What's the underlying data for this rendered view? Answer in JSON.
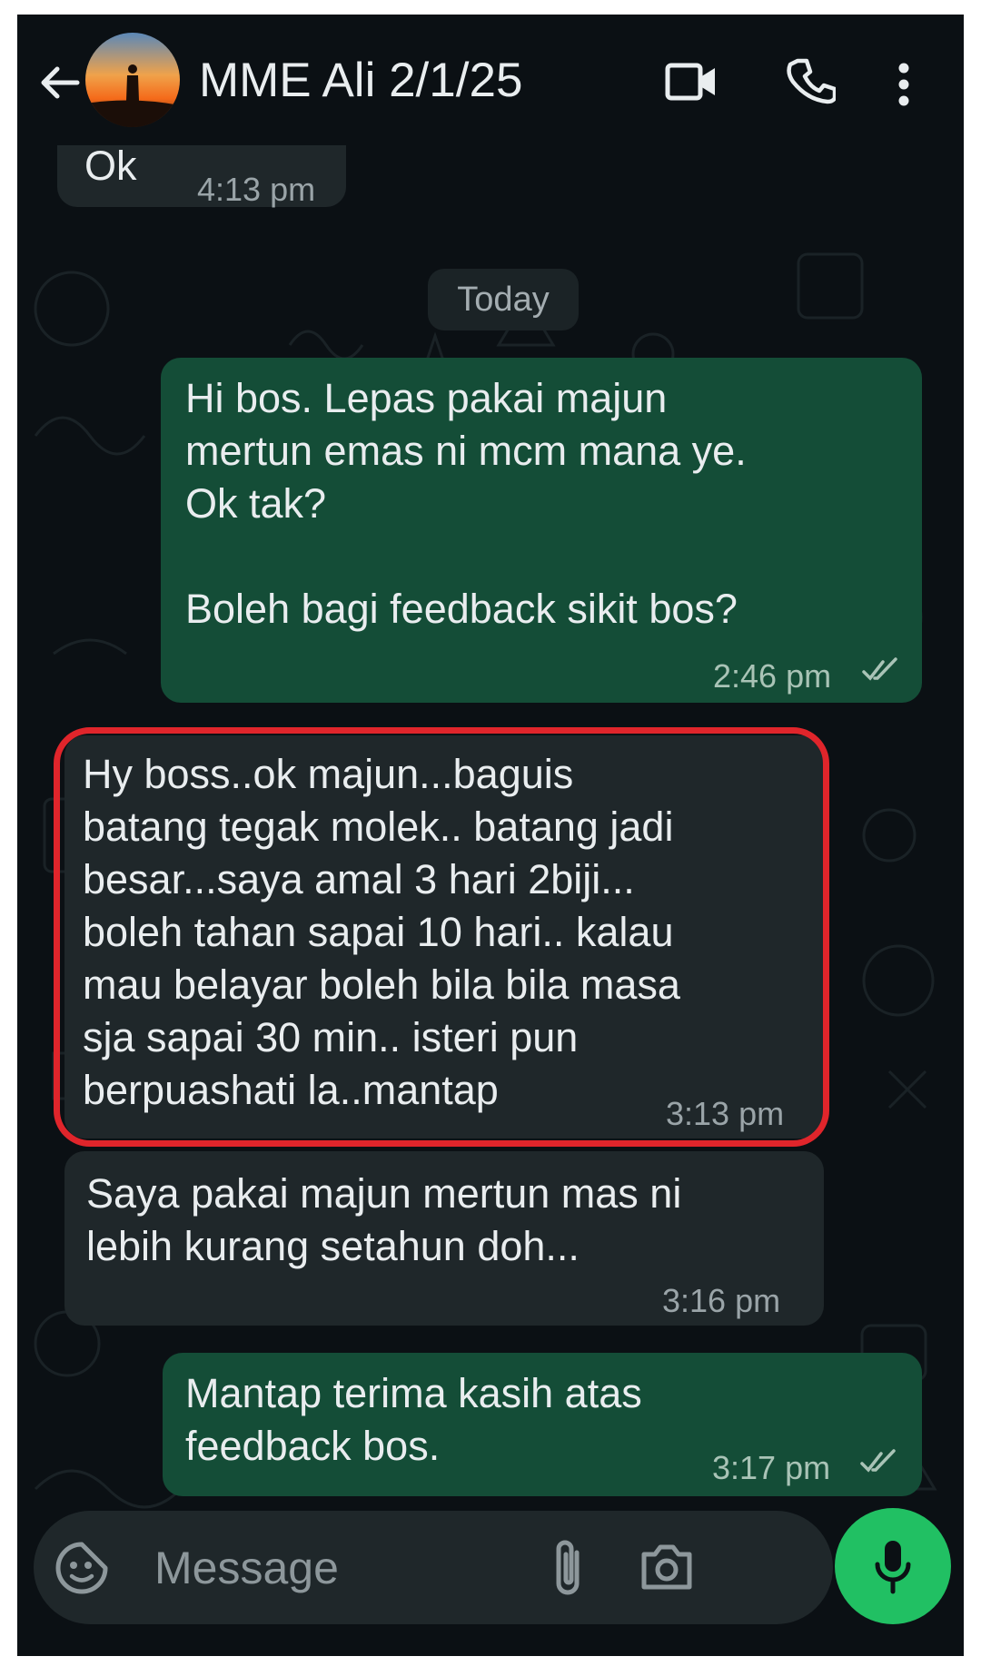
{
  "header": {
    "contact_name": "MME Ali 2/1/25"
  },
  "messages": [
    {
      "direction": "incoming",
      "text": "Ok",
      "time": "4:13 pm"
    },
    {
      "direction": "outgoing",
      "text": "Hi bos. Lepas pakai majun\nmertun emas ni mcm mana ye.\nOk tak?\n\nBoleh bagi feedback sikit bos?",
      "time": "2:46 pm",
      "status": "read"
    },
    {
      "direction": "incoming",
      "text": "Hy boss..ok majun...baguis\nbatang tegak molek.. batang jadi\nbesar...saya amal 3 hari 2biji...\nboleh tahan sapai 10 hari.. kalau\nmau belayar boleh bila bila masa\nsja sapai 30 min.. isteri pun\nberpuashati la..mantap",
      "time": "3:13 pm",
      "highlighted": true
    },
    {
      "direction": "incoming",
      "text": "Saya pakai majun mertun mas ni\nlebih kurang setahun doh...",
      "time": "3:16 pm"
    },
    {
      "direction": "outgoing",
      "text": "Mantap terima kasih atas\nfeedback bos.",
      "time": "3:17 pm",
      "status": "read"
    }
  ],
  "date_divider": "Today",
  "composer": {
    "placeholder": "Message"
  },
  "colors": {
    "background": "#0b1014",
    "incoming_bubble": "#1f272a",
    "outgoing_bubble": "#144d37",
    "mic_button": "#21c063",
    "highlight_border": "#e0252b"
  },
  "icons": [
    "back-arrow-icon",
    "video-call-icon",
    "voice-call-icon",
    "more-options-icon",
    "read-ticks-icon",
    "sticker-icon",
    "attach-icon",
    "camera-icon",
    "mic-icon"
  ]
}
